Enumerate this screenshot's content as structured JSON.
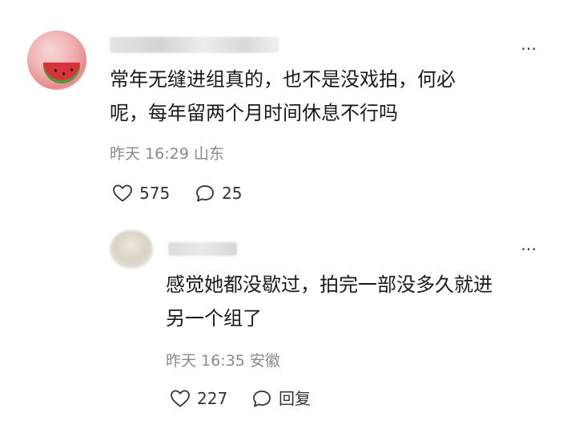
{
  "comment": {
    "text_line1": "常年无缝进组真的，也不是没戏拍，何必",
    "text_line2": "呢，每年留两个月时间休息不行吗",
    "time": "昨天 16:29",
    "location": "山东",
    "likes": "575",
    "replies": "25",
    "more_icon": "more-dots-icon"
  },
  "reply": {
    "text_line1": "感觉她都没歇过，拍完一部没多久就进",
    "text_line2": "另一个组了",
    "time": "昨天 16:35",
    "location": "安徽",
    "likes": "227",
    "reply_label": "回复",
    "more_icon": "more-dots-icon"
  },
  "colors": {
    "text": "#1a1a1a",
    "meta": "#8a8a8a",
    "icon": "#333333"
  }
}
